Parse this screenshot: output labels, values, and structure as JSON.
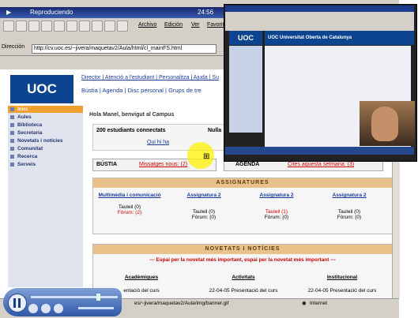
{
  "main_window": {
    "title": "Reproduciendo",
    "time": "24:56",
    "menu": [
      "Archivo",
      "Edición",
      "Ver",
      "Favoritos"
    ],
    "address_label": "Dirección",
    "address_value": "http://cv.uoc.es/~jivera/maquetav2/Aula/html/cl_mainFS.html"
  },
  "logo": "UOC",
  "top_links": "Director | Atenció a l'estudiant | Personalitza | Ajuda | Su",
  "top_links2": "Bústia | Agenda | Disc personal | Grups de tre",
  "sidebar": {
    "items": [
      {
        "label": "Inici"
      },
      {
        "label": "Aules"
      },
      {
        "label": "Biblioteca"
      },
      {
        "label": "Secretaria"
      },
      {
        "label": "Novetats i notícies"
      },
      {
        "label": "Comunitat"
      },
      {
        "label": "Recerca"
      },
      {
        "label": "Serveis"
      }
    ]
  },
  "greeting": "Hola Manel, benvigut al Campus",
  "connected": {
    "label": "200 estudiants connectats",
    "link": "Qui hi ha",
    "right": "Nulla"
  },
  "bustia": {
    "label": "BÚSTIA",
    "link": "Missatges nous: (2)"
  },
  "agenda": {
    "label": "AGENDA",
    "link": "Cites aquesta setmana: (3)"
  },
  "assignatures": {
    "title": "ASSIGNATURES",
    "columns": [
      {
        "name": "Multimèdia i comunicació",
        "line1": "Tauleil (0)",
        "line2": "Fòrum: (2)"
      },
      {
        "name": "Assignatura 2",
        "line1": "Tauleil (0)",
        "line2": "Fòrum: (0)"
      },
      {
        "name": "Assignatura 2",
        "line1": "Tauleil (1)",
        "line2": "Fòrum: (0)"
      },
      {
        "name": "Assignatura 2",
        "line1": "Tauleil (0)",
        "line2": "Fòrum: (0)"
      }
    ]
  },
  "novetats": {
    "title": "NOVETATS I NOTÍCIES",
    "subtitle": "--- Espai per la novetat més important, espai per la novetat més important ---",
    "columns": [
      {
        "name": "Acadèmiques",
        "item": "entació del curs"
      },
      {
        "name": "Activitats",
        "item": "22-04-05 Presentació del curs"
      },
      {
        "name": "Institucional",
        "item": "22-04-05 Presentació del curs"
      }
    ]
  },
  "statusbar": {
    "path": "es/~jivera/maquetav2/Aula/img/banner.gif",
    "zone": "Internet"
  },
  "inset": {
    "logo": "UOC",
    "header": "UOC Universitat Oberta de Catalunya"
  }
}
